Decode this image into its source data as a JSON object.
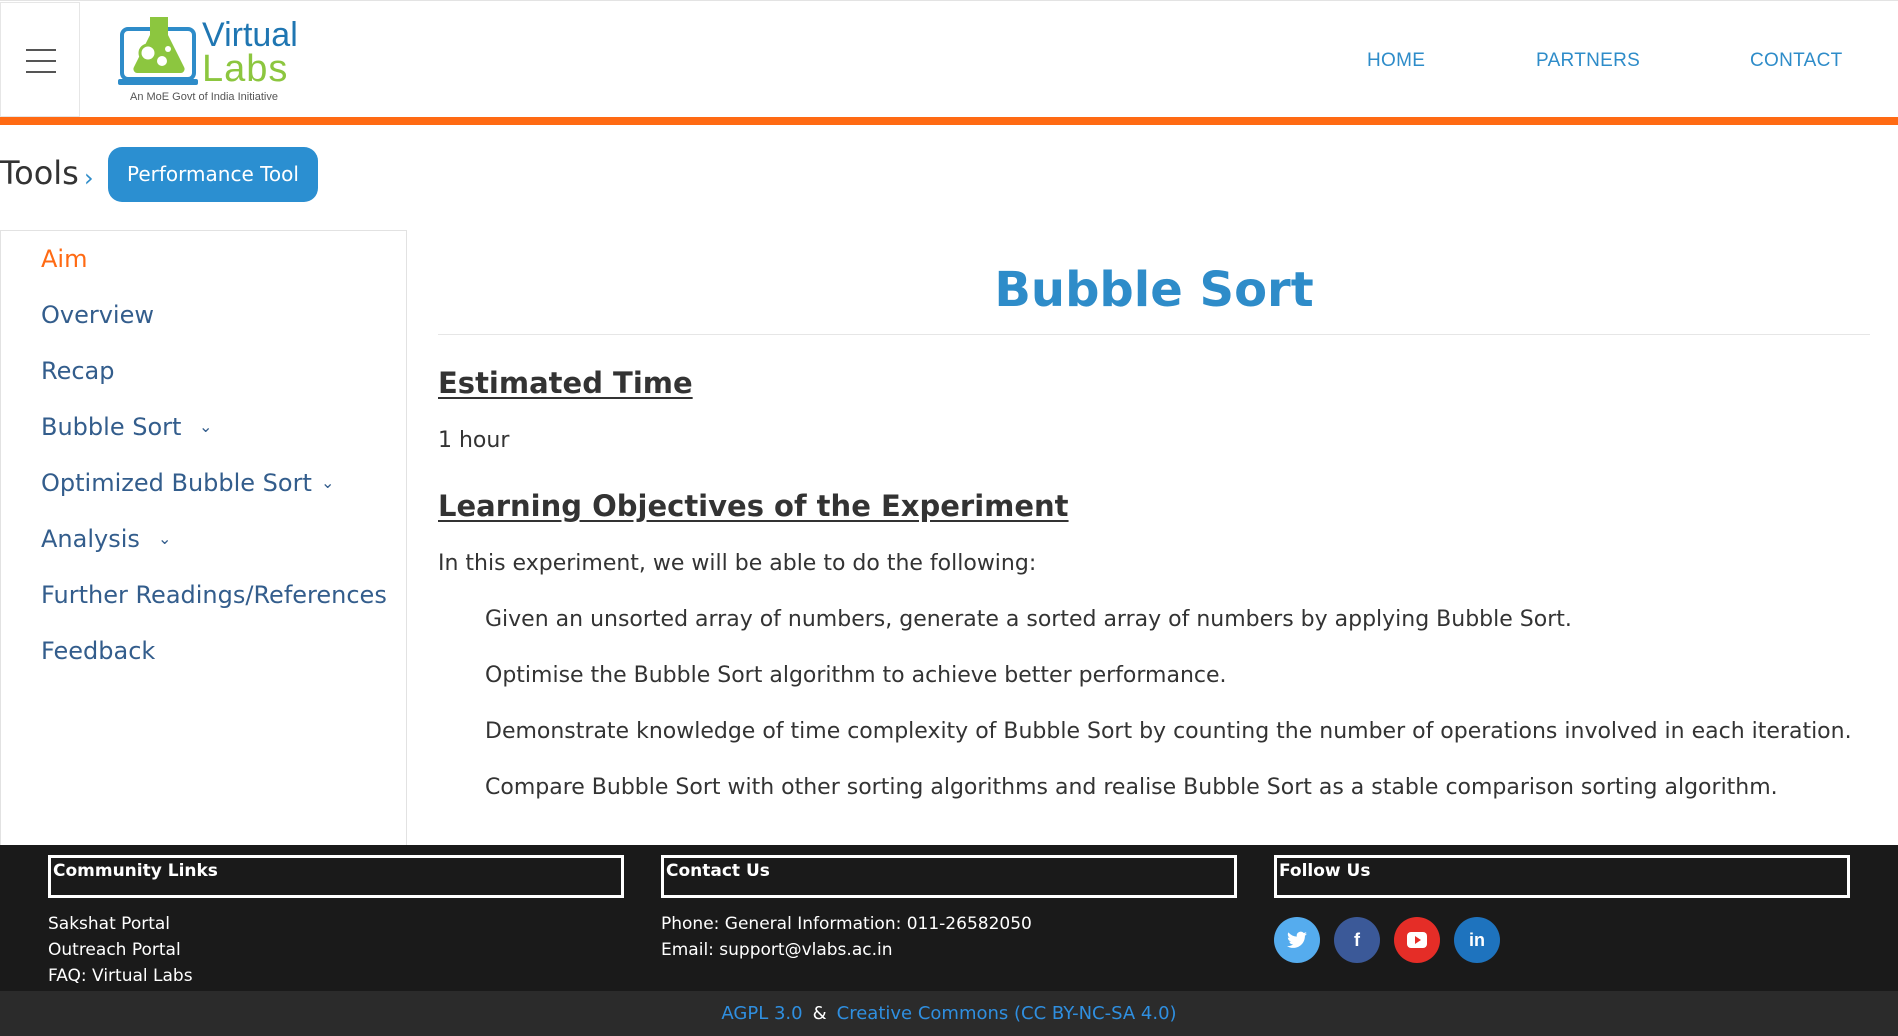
{
  "header": {
    "logo": {
      "line1": "Virtual",
      "line2": "Labs",
      "tagline": "An MoE Govt of India Initiative"
    },
    "nav": [
      "HOME",
      "PARTNERS",
      "CONTACT"
    ]
  },
  "breadcrumb": {
    "root": "Tools",
    "active": "Performance Tool"
  },
  "sidebar": {
    "items": [
      {
        "label": "Aim"
      },
      {
        "label": "Overview"
      },
      {
        "label": "Recap"
      },
      {
        "label": "Bubble Sort"
      },
      {
        "label": "Optimized Bubble Sort"
      },
      {
        "label": "Analysis"
      },
      {
        "label": "Further Readings/References"
      },
      {
        "label": "Feedback"
      }
    ]
  },
  "main": {
    "title": "Bubble Sort",
    "estimated_time_heading": "Estimated Time",
    "estimated_time": "1 hour",
    "objectives_heading": "Learning Objectives of the Experiment",
    "intro": "In this experiment, we will be able to do the following:",
    "objectives": [
      "Given an unsorted array of numbers, generate a sorted array of numbers by applying Bubble Sort.",
      "Optimise the Bubble Sort algorithm to achieve better performance.",
      "Demonstrate knowledge of time complexity of Bubble Sort by counting the number of operations involved in each iteration.",
      "Compare Bubble Sort with other sorting algorithms and realise Bubble Sort as a stable comparison sorting algorithm."
    ]
  },
  "footer": {
    "community": {
      "heading": "Community Links",
      "links": [
        "Sakshat Portal",
        "Outreach Portal",
        "FAQ: Virtual Labs"
      ]
    },
    "contact": {
      "heading": "Contact Us",
      "phone": "Phone: General Information: 011-26582050",
      "email": "Email: support@vlabs.ac.in"
    },
    "follow": {
      "heading": "Follow Us",
      "icons": [
        "twitter-icon",
        "facebook-icon",
        "youtube-icon",
        "linkedin-icon"
      ]
    },
    "license": {
      "agpl": "AGPL 3.0",
      "amp": "&",
      "cc": "Creative Commons (CC BY-NC-SA 4.0)"
    }
  },
  "colors": {
    "accent": "#2e8cc9",
    "orange": "#ff6a13",
    "sidebar_text": "#335d8c"
  }
}
